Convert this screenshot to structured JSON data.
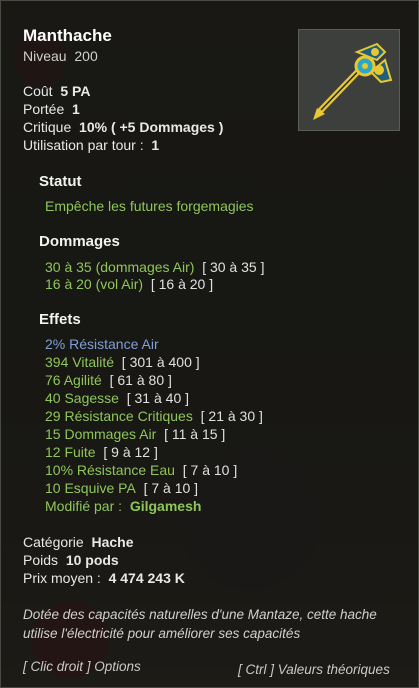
{
  "item": {
    "name": "Manthache",
    "level_label": "Niveau",
    "level": "200",
    "icon": "axe-icon"
  },
  "stats": {
    "cost_label": "Coût",
    "cost": "5 PA",
    "range_label": "Portée",
    "range": "1",
    "crit_label": "Critique",
    "crit": "10% ( +5 Dommages )",
    "uses_label": "Utilisation par tour :",
    "uses": "1"
  },
  "statut": {
    "title": "Statut",
    "text": "Empêche les futures forgemagies"
  },
  "dommages": {
    "title": "Dommages",
    "lines": [
      {
        "value": "30 à 35 (dommages Air)",
        "range": "[ 30 à 35 ]"
      },
      {
        "value": "16 à 20 (vol Air)",
        "range": "[ 16 à 20 ]"
      }
    ]
  },
  "effets": {
    "title": "Effets",
    "lines": [
      {
        "value": "2% Résistance Air",
        "range": ""
      },
      {
        "value": "394 Vitalité",
        "range": "[ 301 à 400 ]"
      },
      {
        "value": "76 Agilité",
        "range": "[ 61 à 80 ]"
      },
      {
        "value": "40 Sagesse",
        "range": "[ 31 à 40 ]"
      },
      {
        "value": "29 Résistance Critiques",
        "range": "[ 21 à 30 ]"
      },
      {
        "value": "15 Dommages Air",
        "range": "[ 11 à 15 ]"
      },
      {
        "value": "12 Fuite",
        "range": "[ 9 à 12 ]"
      },
      {
        "value": "10% Résistance Eau",
        "range": "[ 7 à 10 ]"
      },
      {
        "value": "10 Esquive PA",
        "range": "[ 7 à 10 ]"
      }
    ],
    "modified_label": "Modifié par :",
    "modified_by": "Gilgamesh"
  },
  "info": {
    "category_label": "Catégorie",
    "category": "Hache",
    "weight_label": "Poids",
    "weight": "10 pods",
    "price_label": "Prix moyen :",
    "price": "4 474 243 K"
  },
  "description": "Dotée des capacités naturelles d'une Mantaze, cette hache utilise l'électricité pour améliorer ses capacités",
  "hints": {
    "right_click": "[ Clic droit ] Options",
    "ctrl": "[ Ctrl ] Valeurs théoriques"
  },
  "colors": {
    "green": "#8fc65a",
    "blue": "#7f9fd6"
  }
}
